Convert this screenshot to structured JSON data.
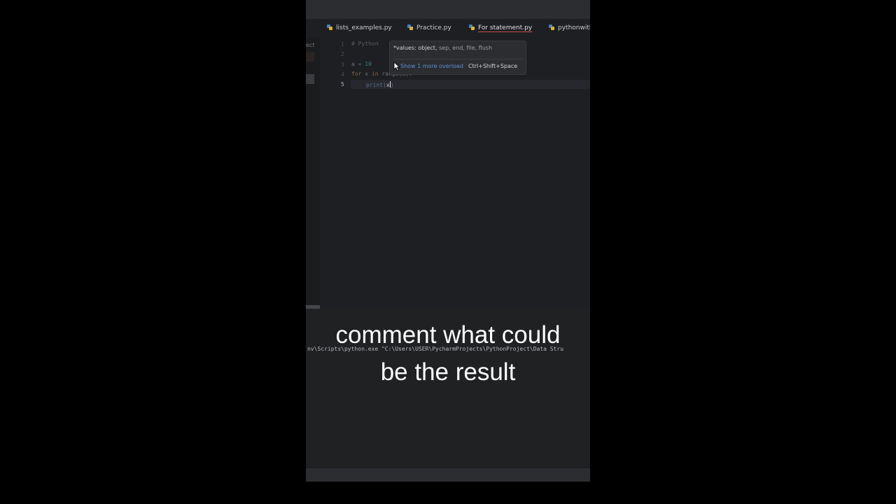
{
  "tabs": [
    {
      "label": "lists_examples.py",
      "active": false
    },
    {
      "label": "Practice.py",
      "active": false
    },
    {
      "label": "For statement.py",
      "active": true
    },
    {
      "label": "pythonwith",
      "active": false
    }
  ],
  "project_panel": {
    "label": "ect"
  },
  "line_numbers": [
    "1",
    "2",
    "3",
    "4",
    "5"
  ],
  "code": {
    "line1": "# Python",
    "line3_var": "a",
    "line3_eq": " = ",
    "line3_num": "10",
    "line4_kw": "for",
    "line4_var": " x ",
    "line4_in": "in",
    "line4_rest": " range(a):",
    "line5_fn": "print",
    "line5_open": "(",
    "line5_arg": "x",
    "line5_close": ")"
  },
  "hint": {
    "signature_bold": "*values: object,",
    "signature_rest": " sep, end, file, flush",
    "link": "Show 1 more overload",
    "shortcut": "Ctrl+Shift+Space"
  },
  "run_panel": {
    "command": "nv\\Scripts\\python.exe \"C:\\Users\\USER\\PycharmProjects\\PythonProject\\Data Stru"
  },
  "caption": {
    "line1": "comment what could",
    "line2": "be the result"
  },
  "colors": {
    "background": "#000000",
    "editor_bg": "#1e1f22",
    "active_tab_underline": "#c94f4f",
    "link": "#5e8fd6"
  }
}
